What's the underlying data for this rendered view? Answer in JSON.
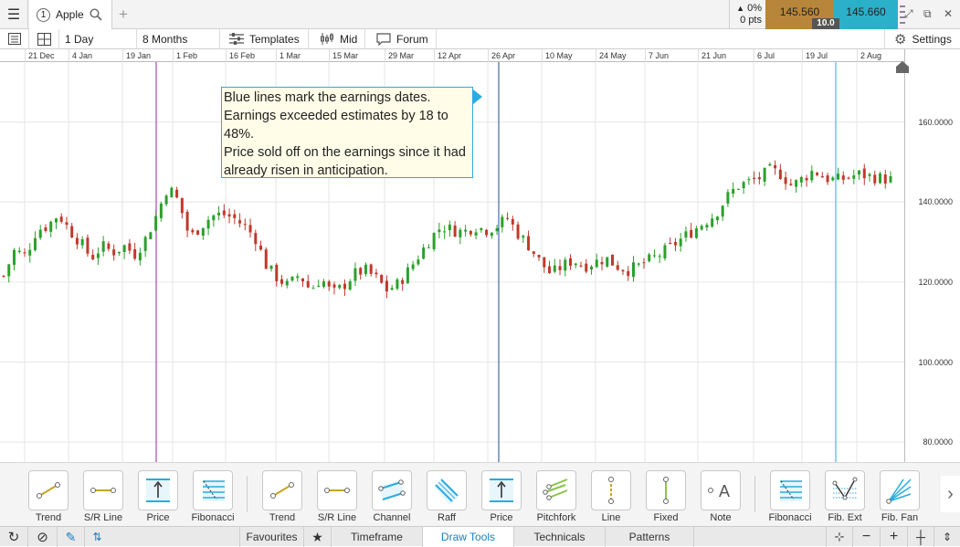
{
  "tab": {
    "number": "1",
    "symbol": "Apple"
  },
  "quote": {
    "change_pct": "0%",
    "change_pts": "0 pts",
    "bid": "145.560",
    "ask": "145.660",
    "spread": "10.0",
    "bid_color": "#b8863a",
    "ask_color": "#2ab0c9"
  },
  "toolbar": {
    "interval": "1 Day",
    "range": "8 Months",
    "templates": "Templates",
    "price_type": "Mid",
    "forum": "Forum",
    "settings": "Settings"
  },
  "date_labels": [
    "21 Dec",
    "4 Jan",
    "19 Jan",
    "1 Feb",
    "16 Feb",
    "1 Mar",
    "15 Mar",
    "29 Mar",
    "12 Apr",
    "26 Apr",
    "10 May",
    "24 May",
    "7 Jun",
    "21 Jun",
    "6 Jul",
    "19 Jul",
    "2 Aug"
  ],
  "y_labels": [
    "160.0000",
    "140.0000",
    "120.0000",
    "100.0000",
    "80.0000"
  ],
  "annotation": {
    "line1": "Blue lines mark the earnings dates.",
    "line2": "Earnings exceeded estimates by 18 to 48%.",
    "line3": "Price sold off on the earnings since it had already risen in anticipation."
  },
  "chart_data": {
    "type": "candlestick",
    "ylim": [
      75,
      175
    ],
    "y_ticks": [
      160,
      140,
      120,
      100,
      80
    ],
    "x_labels": [
      "21 Dec",
      "4 Jan",
      "19 Jan",
      "1 Feb",
      "16 Feb",
      "1 Mar",
      "15 Mar",
      "29 Mar",
      "12 Apr",
      "26 Apr",
      "10 May",
      "24 May",
      "7 Jun",
      "21 Jun",
      "6 Jul",
      "19 Jul",
      "2 Aug"
    ],
    "up_color": "#2ca02c",
    "down_color": "#c0392b",
    "markers": [
      {
        "label": "19 Jan",
        "color": "#a020a0"
      },
      {
        "label": "26 Apr",
        "color": "#1f4e9a"
      },
      {
        "label": "19 Jul",
        "color": "#29abe2"
      }
    ],
    "close_path": [
      121.5,
      128,
      126.5,
      133,
      134,
      137,
      133,
      130,
      126,
      129,
      127.5,
      129,
      127,
      131,
      137,
      144,
      140,
      131,
      134,
      136.5,
      137,
      136,
      134,
      131,
      124,
      121,
      119,
      122,
      118,
      121,
      117,
      119,
      122,
      123,
      121,
      118,
      119.5,
      123,
      127,
      131,
      134,
      133,
      132.5,
      134,
      133,
      134,
      136,
      132,
      129,
      125,
      122,
      124,
      125.5,
      124,
      125,
      126,
      124,
      123,
      124,
      125.5,
      127,
      129,
      131,
      133,
      135,
      137,
      141,
      144,
      145,
      146,
      148,
      147,
      144,
      146,
      148,
      146,
      145.5,
      146,
      147,
      146.5,
      146,
      145.6
    ]
  },
  "draw_tools": [
    {
      "label": "Trend",
      "icon": "trend-line-icon"
    },
    {
      "label": "S/R Line",
      "icon": "sr-line-icon"
    },
    {
      "label": "Price",
      "icon": "price-line-icon"
    },
    {
      "label": "Fibonacci",
      "icon": "fibonacci-icon"
    },
    {
      "label": "Trend",
      "icon": "trend-line-icon"
    },
    {
      "label": "S/R Line",
      "icon": "sr-line-icon"
    },
    {
      "label": "Channel",
      "icon": "channel-icon"
    },
    {
      "label": "Raff",
      "icon": "raff-channel-icon"
    },
    {
      "label": "Price",
      "icon": "price-line-icon"
    },
    {
      "label": "Pitchfork",
      "icon": "pitchfork-icon"
    },
    {
      "label": "Line",
      "icon": "vertical-line-icon"
    },
    {
      "label": "Fixed",
      "icon": "fixed-line-icon"
    },
    {
      "label": "Note",
      "icon": "note-icon"
    },
    {
      "label": "Fibonacci",
      "icon": "fibonacci-icon"
    },
    {
      "label": "Fib. Ext",
      "icon": "fib-extension-icon"
    },
    {
      "label": "Fib. Fan",
      "icon": "fib-fan-icon"
    }
  ],
  "bottom_tabs": [
    "Favourites",
    "Timeframe",
    "Draw Tools",
    "Technicals",
    "Patterns"
  ]
}
